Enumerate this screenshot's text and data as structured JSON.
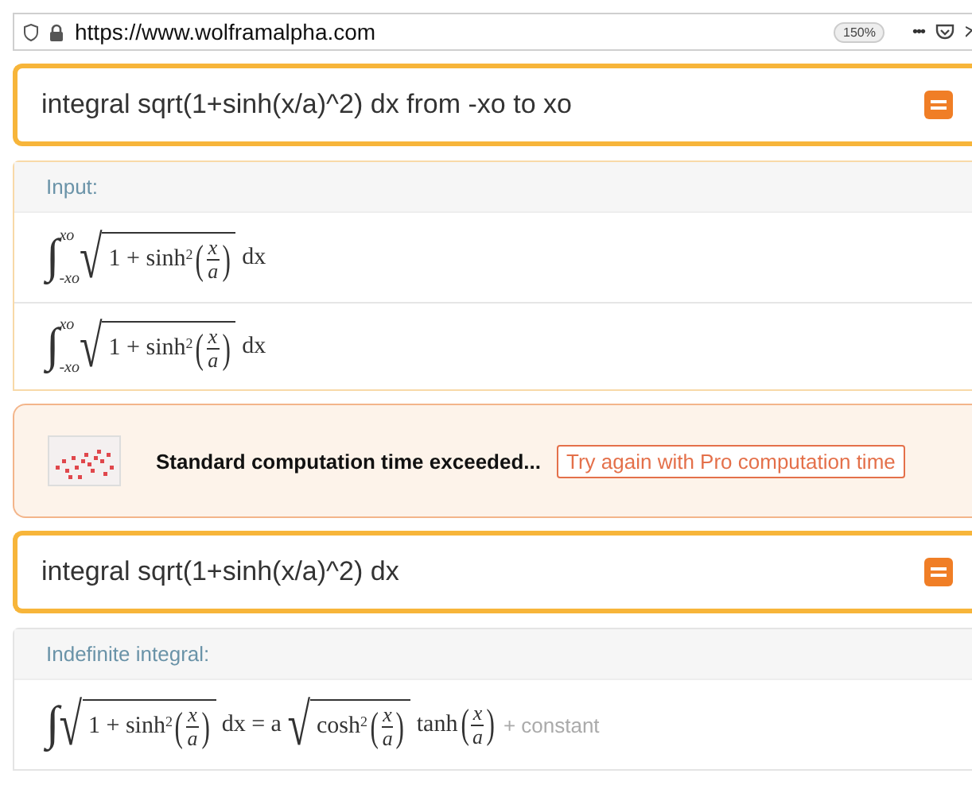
{
  "browser": {
    "url": "https://www.wolframalpha.com",
    "zoom": "150%",
    "menu": "•••"
  },
  "queries": [
    {
      "text": "integral sqrt(1+sinh(x/a)^2) dx from -xo to xo",
      "pod": {
        "title": "Input:",
        "highlighted": true,
        "formulas": [
          [
            {
              "kind": "integral",
              "symbol": "∫",
              "lower": "-xo",
              "upper": "xo"
            },
            {
              "kind": "sqrt",
              "symbol": "√",
              "children": [
                {
                  "kind": "text",
                  "text": "1 + sinh"
                },
                {
                  "kind": "sup",
                  "text": "2"
                },
                {
                  "kind": "paren",
                  "text": "("
                },
                {
                  "kind": "frac",
                  "num": "x",
                  "den": "a"
                },
                {
                  "kind": "paren",
                  "text": ")"
                }
              ]
            },
            {
              "kind": "text",
              "text": " dx"
            }
          ],
          [
            {
              "kind": "integral",
              "symbol": "∫",
              "lower": "-xo",
              "upper": "xo"
            },
            {
              "kind": "sqrt",
              "symbol": "√",
              "children": [
                {
                  "kind": "text",
                  "text": "1 + sinh"
                },
                {
                  "kind": "sup",
                  "text": "2"
                },
                {
                  "kind": "paren",
                  "text": "("
                },
                {
                  "kind": "frac",
                  "num": "x",
                  "den": "a"
                },
                {
                  "kind": "paren",
                  "text": ")"
                }
              ]
            },
            {
              "kind": "text",
              "text": " dx"
            }
          ]
        ]
      },
      "error": {
        "message": "Standard computation time exceeded...",
        "action": "Try again with Pro computation time"
      }
    },
    {
      "text": "integral sqrt(1+sinh(x/a)^2) dx",
      "pod": {
        "title": "Indefinite integral:",
        "highlighted": false,
        "formulas": [
          [
            {
              "kind": "integral",
              "symbol": "∫"
            },
            {
              "kind": "sqrt",
              "symbol": "√",
              "children": [
                {
                  "kind": "text",
                  "text": "1 + sinh"
                },
                {
                  "kind": "sup",
                  "text": "2"
                },
                {
                  "kind": "paren",
                  "text": "("
                },
                {
                  "kind": "frac",
                  "num": "x",
                  "den": "a"
                },
                {
                  "kind": "paren",
                  "text": ")"
                }
              ]
            },
            {
              "kind": "text",
              "text": " dx = a "
            },
            {
              "kind": "sqrt",
              "symbol": "√",
              "children": [
                {
                  "kind": "text",
                  "text": "cosh"
                },
                {
                  "kind": "sup",
                  "text": "2"
                },
                {
                  "kind": "paren",
                  "text": "("
                },
                {
                  "kind": "frac",
                  "num": "x",
                  "den": "a"
                },
                {
                  "kind": "paren",
                  "text": ")"
                }
              ]
            },
            {
              "kind": "text",
              "text": " tanh"
            },
            {
              "kind": "paren",
              "text": "("
            },
            {
              "kind": "frac",
              "num": "x",
              "den": "a"
            },
            {
              "kind": "paren",
              "text": ")"
            },
            {
              "kind": "muted",
              "text": " + constant"
            }
          ]
        ]
      }
    }
  ]
}
